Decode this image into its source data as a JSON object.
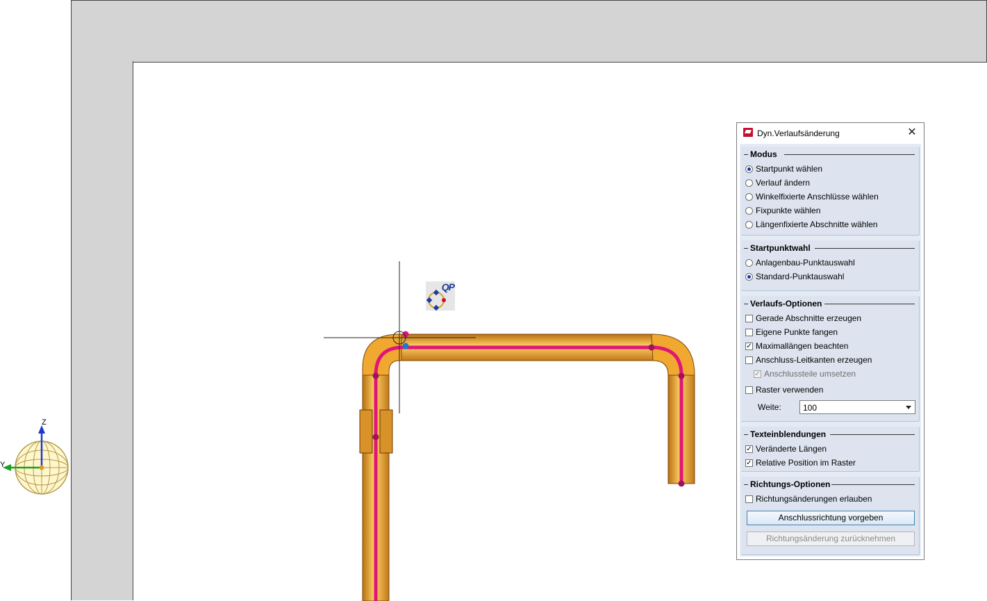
{
  "dialog": {
    "title": "Dyn.Verlaufsänderung",
    "close": "✕",
    "modus": {
      "title": "Modus",
      "options": [
        {
          "label": "Startpunkt wählen",
          "selected": true
        },
        {
          "label": "Verlauf ändern",
          "selected": false
        },
        {
          "label": "Winkelfixierte Anschlüsse wählen",
          "selected": false
        },
        {
          "label": "Fixpunkte wählen",
          "selected": false
        },
        {
          "label": "Längenfixierte Abschnitte wählen",
          "selected": false
        }
      ]
    },
    "startpunktwahl": {
      "title": "Startpunktwahl",
      "options": [
        {
          "label": "Anlagenbau-Punktauswahl",
          "selected": false
        },
        {
          "label": "Standard-Punktauswahl",
          "selected": true
        }
      ]
    },
    "verlaufs_optionen": {
      "title": "Verlaufs-Optionen",
      "checks": [
        {
          "label": "Gerade Abschnitte erzeugen",
          "checked": false
        },
        {
          "label": "Eigene Punkte fangen",
          "checked": false
        },
        {
          "label": "Maximallängen beachten",
          "checked": true
        },
        {
          "label": "Anschluss-Leitkanten erzeugen",
          "checked": false
        },
        {
          "label": "Anschlussteile umsetzen",
          "checked": true,
          "disabled": true
        },
        {
          "label": "Raster verwenden",
          "checked": false
        }
      ],
      "weite_label": "Weite:",
      "weite_value": "100"
    },
    "texteinblendungen": {
      "title": "Texteinblendungen",
      "checks": [
        {
          "label": "Veränderte Längen",
          "checked": true
        },
        {
          "label": "Relative Position im Raster",
          "checked": true
        }
      ]
    },
    "richtungs_optionen": {
      "title": "Richtungs-Optionen",
      "checks": [
        {
          "label": "Richtungsänderungen erlauben",
          "checked": false
        }
      ],
      "btn_primary": "Anschlussrichtung vorgeben",
      "btn_disabled": "Richtungsänderung zurücknehmen"
    }
  },
  "viewport": {
    "qp_label": "QP",
    "axis_z": "Z",
    "axis_y": "Y"
  },
  "colors": {
    "pipe": "#f0a830",
    "pipe_dark": "#c07818",
    "centerline": "#e0157a",
    "wall": "#d4d4d4",
    "dialog_bg": "#e5ebf5"
  }
}
